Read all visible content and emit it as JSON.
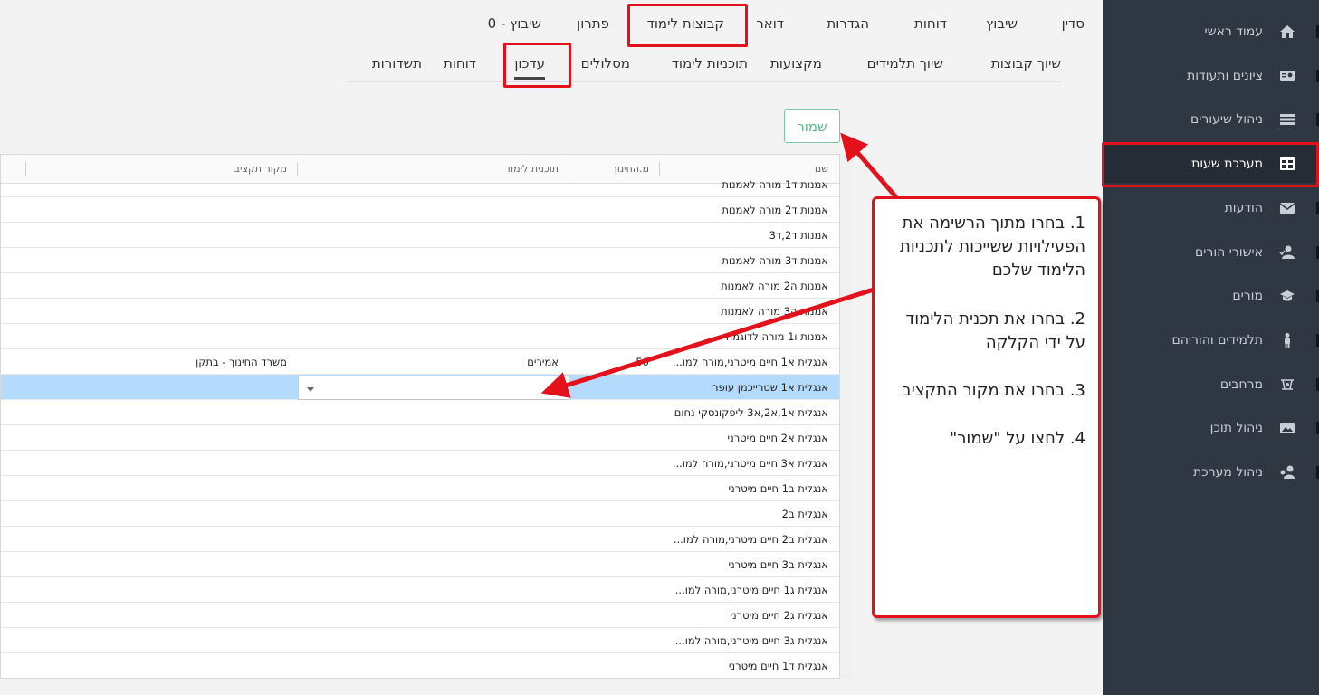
{
  "top_tabs": [
    "סדין",
    "שיבוץ",
    "דוחות",
    "הגדרות",
    "דואר",
    "קבוצות לימוד",
    "פתרון",
    "שיבוץ - 0"
  ],
  "sub_tabs": [
    "שיוך קבוצות",
    "שיוך תלמידים",
    "מקצועות",
    "תוכניות לימוד",
    "מסלולים",
    "עדכון",
    "דוחות",
    "תשדורות"
  ],
  "save_label": "שמור",
  "sidebar": [
    {
      "label": "עמוד ראשי",
      "icon": "home-icon"
    },
    {
      "label": "ציונים ותעודות",
      "icon": "certificate-icon"
    },
    {
      "label": "ניהול שיעורים",
      "icon": "list-icon"
    },
    {
      "label": "מערכת שעות",
      "icon": "timetable-icon"
    },
    {
      "label": "הודעות",
      "icon": "envelope-icon"
    },
    {
      "label": "אישורי הורים",
      "icon": "user-check-icon"
    },
    {
      "label": "מורים",
      "icon": "graduation-cap-icon"
    },
    {
      "label": "תלמידים והוריהם",
      "icon": "child-icon"
    },
    {
      "label": "מרחבים",
      "icon": "spaces-icon"
    },
    {
      "label": "ניהול תוכן",
      "icon": "image-icon"
    },
    {
      "label": "ניהול מערכת",
      "icon": "user-gear-icon"
    }
  ],
  "grid": {
    "headers": {
      "name": "שם",
      "edu": "מ.החינוך",
      "plan": "תוכנית לימוד",
      "source": "מקור תקציב"
    },
    "rows": [
      {
        "name": "אמנות ד1 מורה לאמנות",
        "edu": "",
        "plan": "",
        "source": ""
      },
      {
        "name": "אמנות ד2 מורה לאמנות",
        "edu": "",
        "plan": "",
        "source": ""
      },
      {
        "name": "אמנות ד2,ד3",
        "edu": "",
        "plan": "",
        "source": ""
      },
      {
        "name": "אמנות ד3 מורה לאמנות",
        "edu": "",
        "plan": "",
        "source": ""
      },
      {
        "name": "אמנות ה2 מורה לאמנות",
        "edu": "",
        "plan": "",
        "source": ""
      },
      {
        "name": "אמנות ה3 מורה לאמנות",
        "edu": "",
        "plan": "",
        "source": ""
      },
      {
        "name": "אמנות ו1 מורה לדוגמה",
        "edu": "",
        "plan": "",
        "source": ""
      },
      {
        "name": "אנגלית א1 חיים מיטרני,מורה למו...",
        "edu": "50",
        "plan": "אמירים",
        "source": "משרד החינוך - בתקן"
      },
      {
        "name": "אנגלית א1 שטרייכמן עופר",
        "edu": "",
        "plan": "",
        "source": ""
      },
      {
        "name": "אנגלית א1,א2,א3 ליפקונסקי נחום",
        "edu": "",
        "plan": "",
        "source": ""
      },
      {
        "name": "אנגלית א2 חיים מיטרני",
        "edu": "",
        "plan": "",
        "source": ""
      },
      {
        "name": "אנגלית א3 חיים מיטרני,מורה למו...",
        "edu": "",
        "plan": "",
        "source": ""
      },
      {
        "name": "אנגלית ב1 חיים מיטרני",
        "edu": "",
        "plan": "",
        "source": ""
      },
      {
        "name": "אנגלית ב2",
        "edu": "",
        "plan": "",
        "source": ""
      },
      {
        "name": "אנגלית ב2 חיים מיטרני,מורה למו...",
        "edu": "",
        "plan": "",
        "source": ""
      },
      {
        "name": "אנגלית ב3 חיים מיטרני",
        "edu": "",
        "plan": "",
        "source": ""
      },
      {
        "name": "אנגלית ג1 חיים מיטרני,מורה למו...",
        "edu": "",
        "plan": "",
        "source": ""
      },
      {
        "name": "אנגלית ג2 חיים מיטרני",
        "edu": "",
        "plan": "",
        "source": ""
      },
      {
        "name": "אנגלית ג3 חיים מיטרני,מורה למו...",
        "edu": "",
        "plan": "",
        "source": ""
      },
      {
        "name": "אנגלית ד1 חיים מיטרני",
        "edu": "",
        "plan": "",
        "source": ""
      }
    ]
  },
  "instructions": [
    "1. בחרו מתוך הרשימה את הפעילויות ששייכות לתכניות הלימוד שלכם",
    "2. בחרו את תכנית הלימוד על ידי הקלקה",
    "3. בחרו את מקור התקציב",
    "4. לחצו על \"שמור\""
  ],
  "colors": {
    "sidebar_bg": "#2f3742",
    "highlight": "#e3111b",
    "selected_row": "#b4dbfb",
    "save_green": "#55b484"
  }
}
